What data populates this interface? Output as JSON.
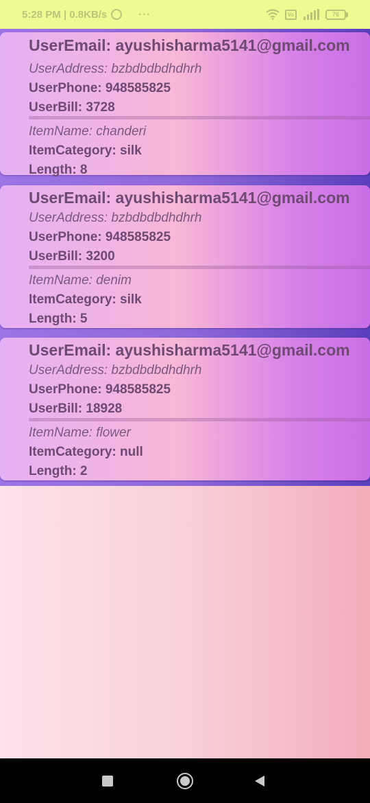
{
  "status_bar": {
    "time_speed": "5:28 PM | 0.8KB/s",
    "dots": "···",
    "volte": "Vo",
    "battery": "76"
  },
  "orders": [
    {
      "user_email": "UserEmail: ayushisharma5141@gmail.com",
      "user_address": "UserAddress: bzbdbdbdhdhrh",
      "user_phone": "UserPhone: 948585825",
      "user_bill": "UserBill: 3728",
      "item_name": "ItemName: chanderi",
      "item_category": "ItemCategory: silk",
      "length": "Length: 8"
    },
    {
      "user_email": "UserEmail: ayushisharma5141@gmail.com",
      "user_address": "UserAddress: bzbdbdbdhdhrh",
      "user_phone": "UserPhone: 948585825",
      "user_bill": "UserBill: 3200",
      "item_name": "ItemName: denim",
      "item_category": "ItemCategory: silk",
      "length": "Length: 5"
    },
    {
      "user_email": "UserEmail: ayushisharma5141@gmail.com",
      "user_address": "UserAddress: bzbdbdbdhdhrh",
      "user_phone": "UserPhone: 948585825",
      "user_bill": "UserBill: 18928",
      "item_name": "ItemName: flower",
      "item_category": "ItemCategory: null",
      "length": "Length: 2"
    }
  ],
  "nav": {
    "recents_icon": "square-icon",
    "home_icon": "circle-icon",
    "back_icon": "triangle-left-icon"
  },
  "colors": {
    "status_bar_bg": "#eefb92",
    "list_bg": "#8f68da",
    "card_text": "#6e4a72",
    "page_bg": "#f9d0d8",
    "nav_bg": "#000000"
  }
}
